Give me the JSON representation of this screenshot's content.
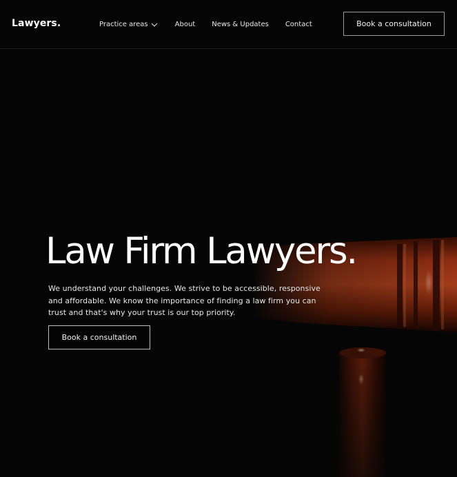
{
  "header": {
    "logo": "Lawyers.",
    "nav": [
      {
        "label": "Practice areas",
        "has_dropdown": true,
        "icon": "chevron-down-icon"
      },
      {
        "label": "About"
      },
      {
        "label": "News & Updates"
      },
      {
        "label": "Contact"
      }
    ],
    "cta": "Book a consultation"
  },
  "hero": {
    "title": "Law Firm Lawyers.",
    "text": "We understand your challenges. We strive to be accessible, responsive and affordable. We know the importance of finding a law firm you can trust and that's why your trust is our top priority.",
    "cta": "Book a consultation",
    "background_image": "gavel"
  },
  "colors": {
    "background": "#050505",
    "text": "#ffffff",
    "button_border": "#9a9a9a",
    "gavel_wood": "#8b2a10"
  }
}
